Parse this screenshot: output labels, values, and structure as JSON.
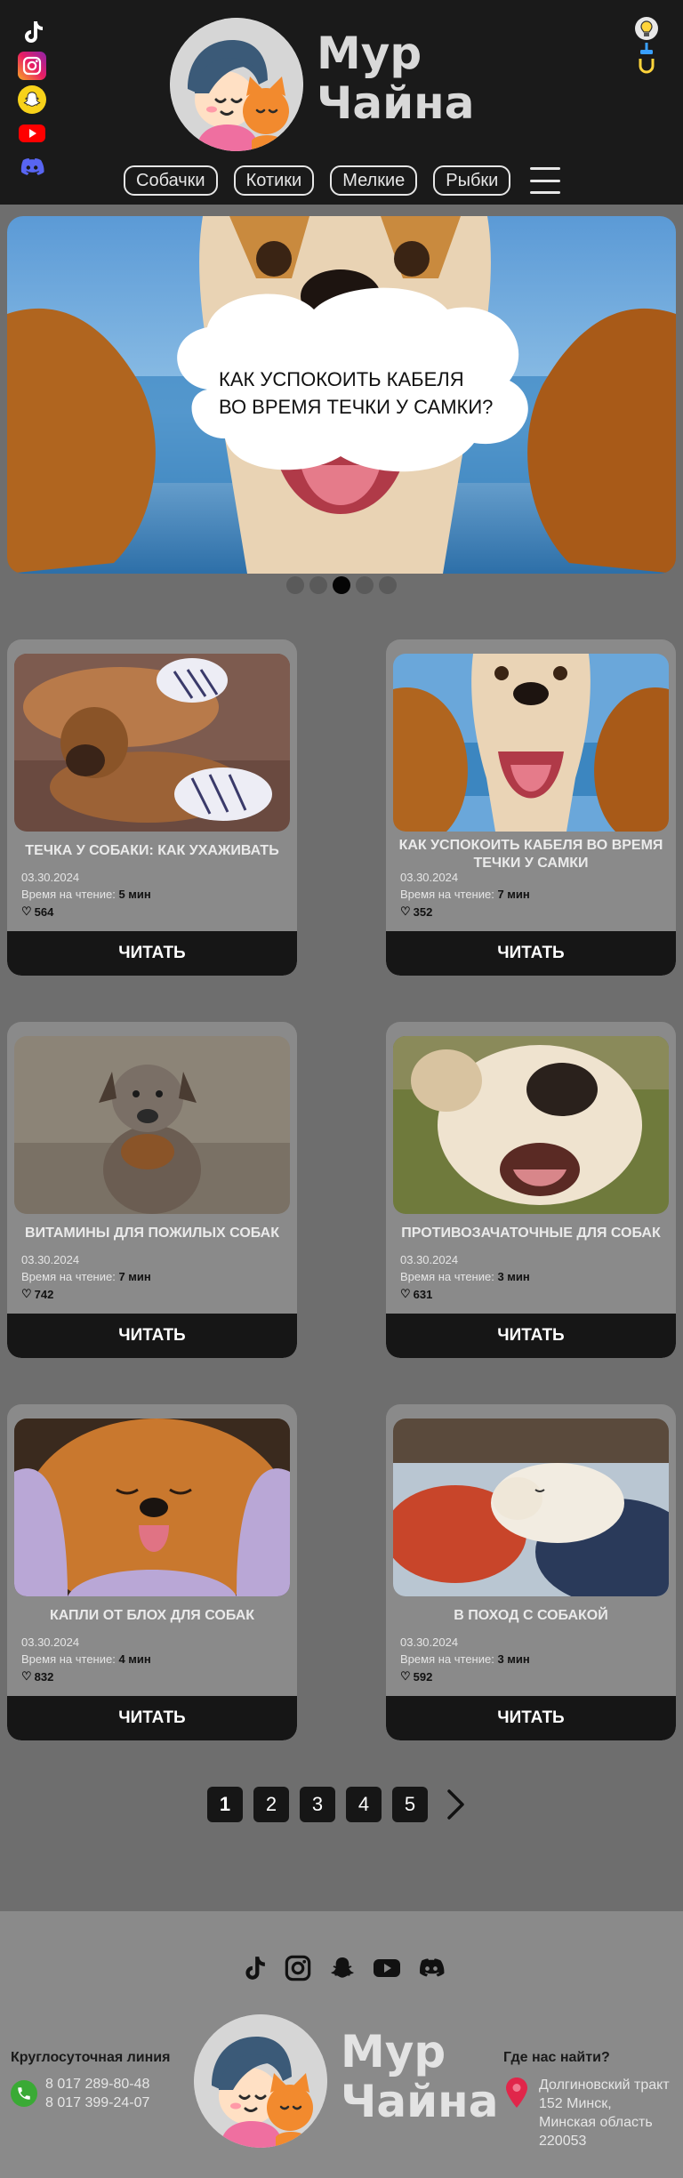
{
  "header": {
    "social": [
      {
        "icon": "tiktok-icon"
      },
      {
        "icon": "instagram-icon"
      },
      {
        "icon": "snapchat-icon"
      },
      {
        "icon": "youtube-icon"
      },
      {
        "icon": "discord-icon"
      }
    ],
    "logo_line1": "Мур",
    "logo_line2": "Чайна",
    "nav": [
      "Собачки",
      "Котики",
      "Мелкие",
      "Рыбки"
    ]
  },
  "hero": {
    "caption_line1": "КАК УСПОКОИТЬ КАБЕЛЯ",
    "caption_line2": "ВО ВРЕМЯ ТЕЧКИ У САМКИ?",
    "slides": 5,
    "active_slide": 3
  },
  "cards": [
    {
      "title": "ТЕЧКА У СОБАКИ: КАК УХАЖИВАТЬ",
      "date": "03.30.2024",
      "read_label": "Время на чтение:",
      "read_time": "5 мин",
      "likes": "564",
      "button": "ЧИТАТЬ"
    },
    {
      "title": "КАК УСПОКОИТЬ КАБЕЛЯ ВО ВРЕМЯ ТЕЧКИ У САМКИ",
      "date": "03.30.2024",
      "read_label": "Время на чтение:",
      "read_time": "7 мин",
      "likes": "352",
      "button": "ЧИТАТЬ"
    },
    {
      "title": "ВИТАМИНЫ ДЛЯ ПОЖИЛЫХ СОБАК",
      "date": "03.30.2024",
      "read_label": "Время на чтение:",
      "read_time": "7 мин",
      "likes": "742",
      "button": "ЧИТАТЬ"
    },
    {
      "title": "ПРОТИВОЗАЧАТОЧНЫЕ ДЛЯ СОБАК",
      "date": "03.30.2024",
      "read_label": "Время на чтение:",
      "read_time": "3 мин",
      "likes": "631",
      "button": "ЧИТАТЬ"
    },
    {
      "title": "КАПЛИ ОТ БЛОХ ДЛЯ СОБАК",
      "date": "03.30.2024",
      "read_label": "Время на чтение:",
      "read_time": "4 мин",
      "likes": "832",
      "button": "ЧИТАТЬ"
    },
    {
      "title": "В ПОХОД С СОБАКОЙ",
      "date": "03.30.2024",
      "read_label": "Время на чтение:",
      "read_time": "3 мин",
      "likes": "592",
      "button": "ЧИТАТЬ"
    }
  ],
  "pagination": {
    "pages": [
      "1",
      "2",
      "3",
      "4",
      "5"
    ],
    "current": "1"
  },
  "footer": {
    "phone_heading": "Круглосуточная линия",
    "phones": [
      "8 017 289-80-48",
      "8 017 399-24-07"
    ],
    "logo_line1": "Мур",
    "logo_line2": "Чайна",
    "address_heading": "Где нас найти?",
    "address": "Долгиновский тракт 152 Минск, Минская область 220053"
  },
  "colors": {
    "header_bg": "#1a1a1a",
    "page_bg": "#6e6e6e",
    "card_bg": "#8a8a8a",
    "button_bg": "#161616",
    "footer_bg": "#8a8a8a"
  }
}
